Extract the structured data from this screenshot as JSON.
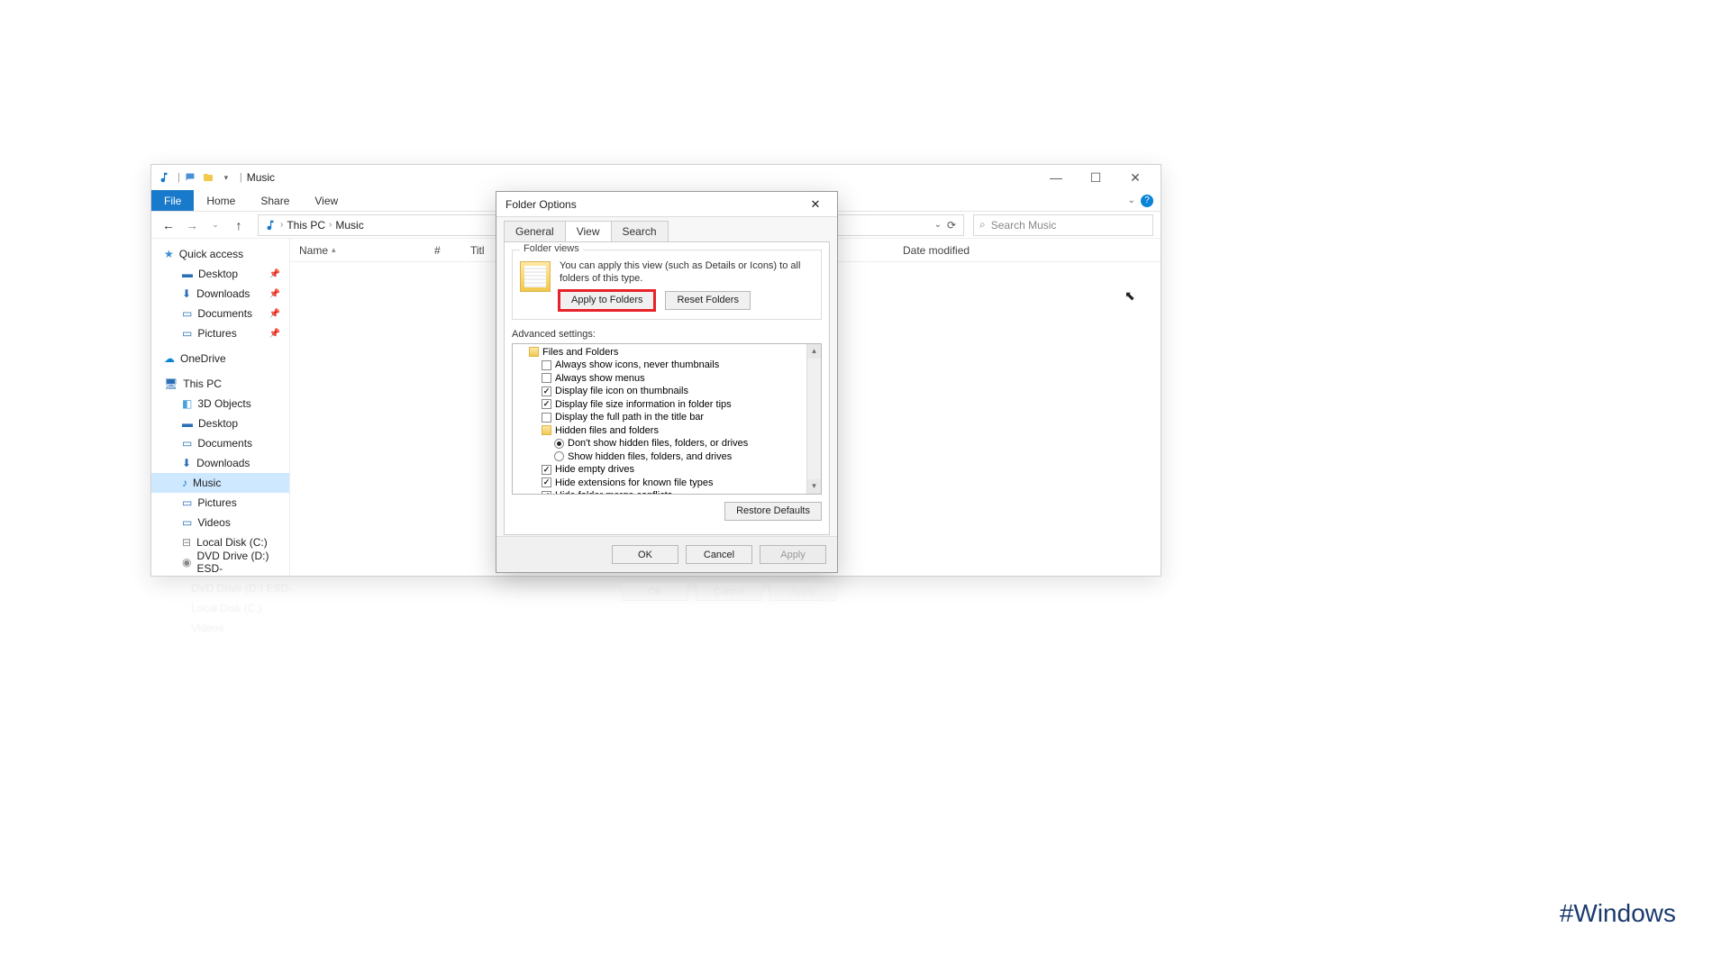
{
  "explorer": {
    "title": "Music",
    "ribbon": {
      "file": "File",
      "home": "Home",
      "share": "Share",
      "view": "View"
    },
    "nav": {
      "back": "←",
      "forward": "→",
      "up": "↑"
    },
    "breadcrumbs": [
      "This PC",
      "Music"
    ],
    "search_placeholder": "Search Music",
    "columns": {
      "name": "Name",
      "num": "#",
      "title": "Titl",
      "date": "Date modified"
    },
    "tree": {
      "quick": "Quick access",
      "quick_items": [
        "Desktop",
        "Downloads",
        "Documents",
        "Pictures"
      ],
      "onedrive": "OneDrive",
      "thispc": "This PC",
      "pc_items": [
        "3D Objects",
        "Desktop",
        "Documents",
        "Downloads",
        "Music",
        "Pictures",
        "Videos",
        "Local Disk (C:)",
        "DVD Drive (D:) ESD-"
      ]
    }
  },
  "dialog": {
    "title": "Folder Options",
    "tabs": {
      "general": "General",
      "view": "View",
      "search": "Search"
    },
    "folder_views": {
      "label": "Folder views",
      "desc": "You can apply this view (such as Details or Icons) to all folders of this type.",
      "apply": "Apply to Folders",
      "reset": "Reset Folders"
    },
    "advanced": {
      "label": "Advanced settings:",
      "root": "Files and Folders",
      "items": [
        {
          "type": "checkbox",
          "checked": false,
          "label": "Always show icons, never thumbnails"
        },
        {
          "type": "checkbox",
          "checked": false,
          "label": "Always show menus"
        },
        {
          "type": "checkbox",
          "checked": true,
          "label": "Display file icon on thumbnails"
        },
        {
          "type": "checkbox",
          "checked": true,
          "label": "Display file size information in folder tips"
        },
        {
          "type": "checkbox",
          "checked": false,
          "label": "Display the full path in the title bar"
        },
        {
          "type": "folder",
          "label": "Hidden files and folders"
        },
        {
          "type": "radio",
          "checked": true,
          "label": "Don't show hidden files, folders, or drives"
        },
        {
          "type": "radio",
          "checked": false,
          "label": "Show hidden files, folders, and drives"
        },
        {
          "type": "checkbox",
          "checked": true,
          "label": "Hide empty drives"
        },
        {
          "type": "checkbox",
          "checked": true,
          "label": "Hide extensions for known file types"
        },
        {
          "type": "checkbox",
          "checked": true,
          "label": "Hide folder merge conflicts"
        }
      ],
      "restore": "Restore Defaults"
    },
    "footer": {
      "ok": "OK",
      "cancel": "Cancel",
      "apply": "Apply"
    }
  },
  "hashtag": "#Windows"
}
